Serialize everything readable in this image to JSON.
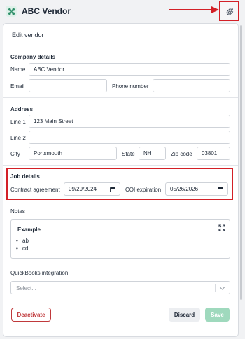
{
  "header": {
    "title": "ABC Vendor"
  },
  "panel": {
    "title": "Edit vendor"
  },
  "company": {
    "title": "Company details",
    "name_label": "Name",
    "name_value": "ABC Vendor",
    "email_label": "Email",
    "email_value": "",
    "phone_label": "Phone number",
    "phone_value": ""
  },
  "address": {
    "title": "Address",
    "line1_label": "Line 1",
    "line1_value": "123 Main Street",
    "line2_label": "Line 2",
    "line2_value": "",
    "city_label": "City",
    "city_value": "Portsmouth",
    "state_label": "State",
    "state_value": "NH",
    "zip_label": "Zip code",
    "zip_value": "03801"
  },
  "job": {
    "title": "Job details",
    "contract_label": "Contract agreement",
    "contract_value": "09/29/2024",
    "coi_label": "COI expiration",
    "coi_value": "05/26/2026"
  },
  "notes": {
    "title": "Notes",
    "heading": "Example",
    "items": [
      "ab",
      "cd"
    ]
  },
  "quickbooks": {
    "title": "QuickBooks integration",
    "placeholder": "Select..."
  },
  "actions": {
    "deactivate": "Deactivate",
    "discard": "Discard",
    "save": "Save"
  },
  "colors": {
    "annotation_red": "#d32027",
    "deactivate_red": "#c0393b",
    "save_green": "#9fd9bd",
    "brand_green": "#2f8f6a"
  },
  "icons": {
    "vendor": "vendor-logo-icon",
    "attach": "paperclip-icon",
    "calendar": "calendar-icon",
    "expand": "expand-icon",
    "dropdown": "chevron-down-icon"
  }
}
